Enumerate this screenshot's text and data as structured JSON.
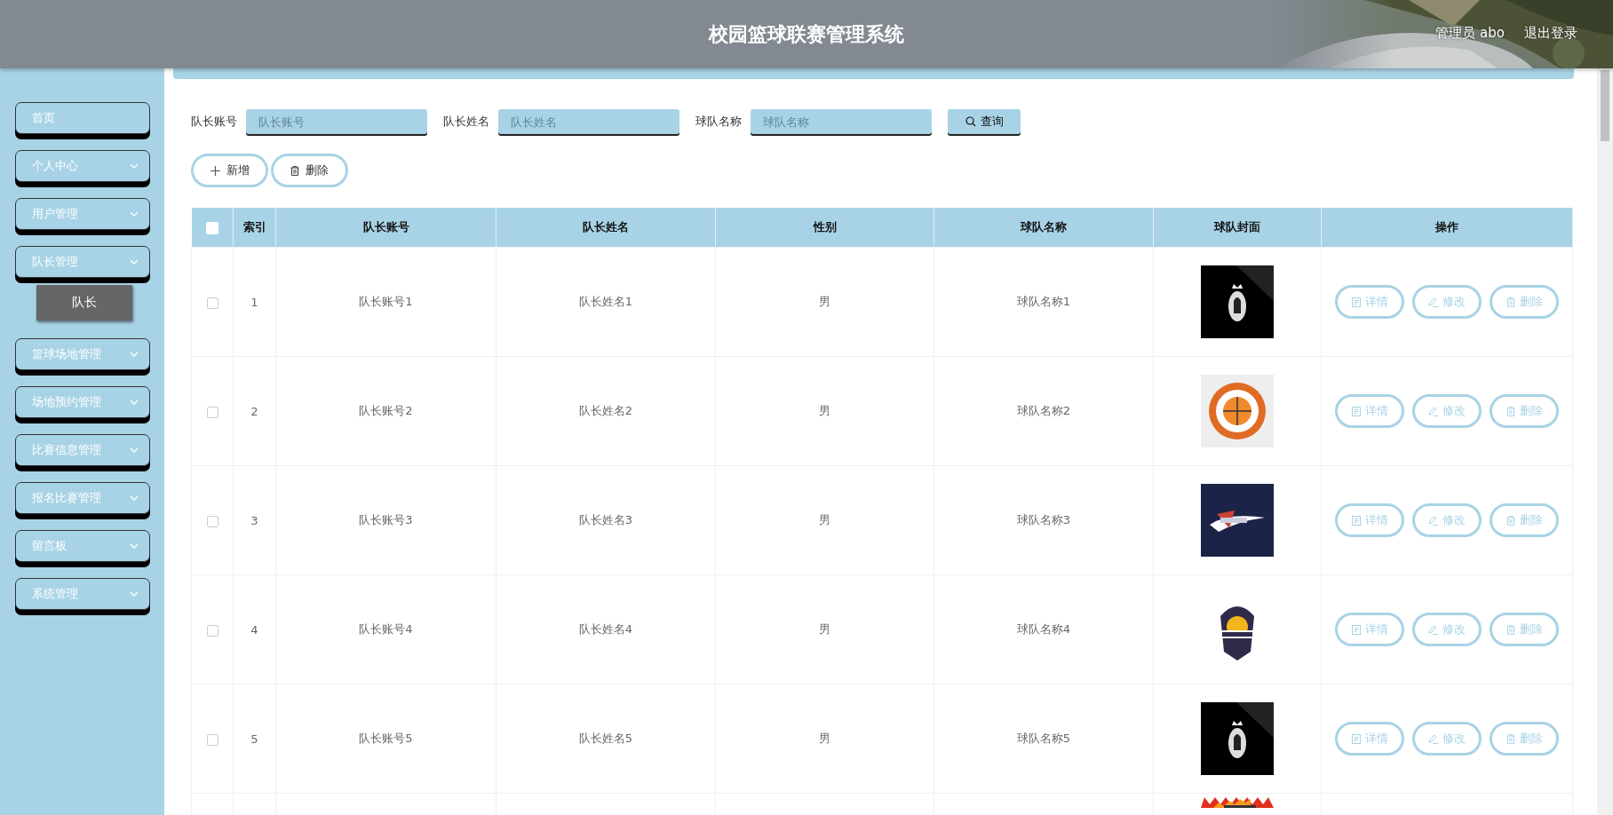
{
  "header": {
    "title": "校园篮球联赛管理系统",
    "user": "管理员 abo",
    "logout": "退出登录"
  },
  "sidebar": {
    "items": [
      {
        "label": "首页",
        "kind": "link"
      },
      {
        "label": "个人中心",
        "kind": "menu"
      },
      {
        "label": "用户管理",
        "kind": "menu"
      },
      {
        "label": "队长管理",
        "kind": "menu",
        "children": [
          {
            "label": "队长",
            "selected": true
          }
        ]
      },
      {
        "label": "篮球场地管理",
        "kind": "menu"
      },
      {
        "label": "场地预约管理",
        "kind": "menu"
      },
      {
        "label": "比赛信息管理",
        "kind": "menu"
      },
      {
        "label": "报名比赛管理",
        "kind": "menu"
      },
      {
        "label": "留言板",
        "kind": "menu"
      },
      {
        "label": "系统管理",
        "kind": "menu"
      }
    ]
  },
  "search": {
    "fields": [
      {
        "label": "队长账号",
        "placeholder": "队长账号"
      },
      {
        "label": "队长姓名",
        "placeholder": "队长姓名"
      },
      {
        "label": "球队名称",
        "placeholder": "球队名称"
      }
    ],
    "button": "查询"
  },
  "actions": [
    {
      "label": "新增",
      "kind": "add"
    },
    {
      "label": "删除",
      "kind": "delete"
    }
  ],
  "table": {
    "header_checked": false,
    "columns": [
      "索引",
      "队长账号",
      "队长姓名",
      "性别",
      "球队名称",
      "球队封面",
      "操作"
    ],
    "rows": [
      {
        "checked": false,
        "index": "1",
        "account": "队长账号1",
        "name": "队长姓名1",
        "gender": "男",
        "team": "球队名称1",
        "actions": [
          {
            "label": "详情",
            "kind": "detail"
          },
          {
            "label": "修改",
            "kind": "edit"
          },
          {
            "label": "删除",
            "kind": "delete"
          }
        ]
      },
      {
        "checked": false,
        "index": "2",
        "account": "队长账号2",
        "name": "队长姓名2",
        "gender": "男",
        "team": "球队名称2",
        "actions": [
          {
            "label": "详情",
            "kind": "detail"
          },
          {
            "label": "修改",
            "kind": "edit"
          },
          {
            "label": "删除",
            "kind": "delete"
          }
        ]
      },
      {
        "checked": false,
        "index": "3",
        "account": "队长账号3",
        "name": "队长姓名3",
        "gender": "男",
        "team": "球队名称3",
        "actions": [
          {
            "label": "详情",
            "kind": "detail"
          },
          {
            "label": "修改",
            "kind": "edit"
          },
          {
            "label": "删除",
            "kind": "delete"
          }
        ]
      },
      {
        "checked": false,
        "index": "4",
        "account": "队长账号4",
        "name": "队长姓名4",
        "gender": "男",
        "team": "球队名称4",
        "actions": [
          {
            "label": "详情",
            "kind": "detail"
          },
          {
            "label": "修改",
            "kind": "edit"
          },
          {
            "label": "删除",
            "kind": "delete"
          }
        ]
      },
      {
        "checked": false,
        "index": "5",
        "account": "队长账号5",
        "name": "队长姓名5",
        "gender": "男",
        "team": "球队名称5",
        "actions": [
          {
            "label": "详情",
            "kind": "detail"
          },
          {
            "label": "修改",
            "kind": "edit"
          },
          {
            "label": "删除",
            "kind": "delete"
          }
        ]
      }
    ]
  }
}
